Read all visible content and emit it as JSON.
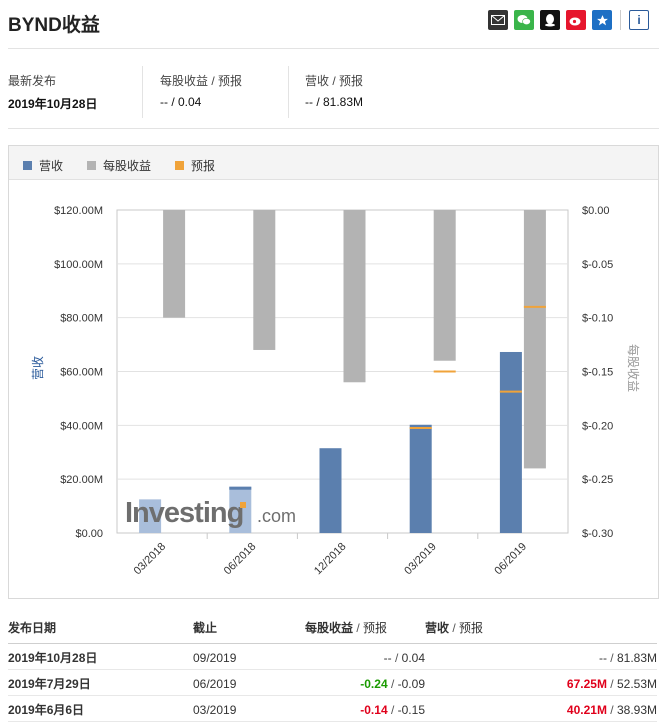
{
  "header": {
    "title": "BYND收益",
    "share_icons": [
      "mail-icon",
      "wechat-icon",
      "qq-icon",
      "weibo-icon",
      "star-icon",
      "info-icon"
    ]
  },
  "summary": {
    "latest_label": "最新发布",
    "latest_date": "2019年10月28日",
    "eps_label": "每股收益 / 预报",
    "eps_value": "-- / 0.04",
    "rev_label": "营收 / 预报",
    "rev_value": "-- / 81.83M"
  },
  "legend": {
    "revenue": "营收",
    "eps": "每股收益",
    "forecast": "预报"
  },
  "colors": {
    "revenue": "#5b7fae",
    "revenue_forecast_bar": "#a9bedb",
    "eps": "#b3b3b3",
    "forecast": "#f0a33a",
    "negative": "#e0001b",
    "positive": "#1a9b00"
  },
  "chart_data": {
    "type": "bar",
    "categories": [
      "03/2018",
      "06/2018",
      "12/2018",
      "03/2019",
      "06/2019"
    ],
    "y_left_label": "营收",
    "y_right_label": "每股收益",
    "y_left_ticks": [
      "$120.00M",
      "$100.00M",
      "$80.00M",
      "$60.00M",
      "$40.00M",
      "$20.00M",
      "$0.00"
    ],
    "y_right_ticks": [
      "$0.00",
      "$-0.05",
      "$-0.10",
      "$-0.15",
      "$-0.20",
      "$-0.25",
      "$-0.30"
    ],
    "y_left_range": [
      0,
      120
    ],
    "y_right_range": [
      -0.3,
      0
    ],
    "series": [
      {
        "name": "营收",
        "axis": "left",
        "values": [
          null,
          null,
          31.5,
          40.21,
          67.25
        ]
      },
      {
        "name": "营收 预报",
        "axis": "left",
        "values": [
          12.5,
          17.2,
          null,
          39.0,
          52.53
        ]
      },
      {
        "name": "每股收益",
        "axis": "right",
        "values": [
          -0.1,
          -0.13,
          -0.16,
          -0.14,
          -0.24
        ]
      },
      {
        "name": "预报",
        "axis": "right",
        "values": [
          null,
          null,
          null,
          -0.15,
          -0.09
        ]
      }
    ],
    "watermark": "Investing.com"
  },
  "table": {
    "headers": [
      "发布日期",
      "截止",
      "每股收益",
      "预报",
      "营收",
      "预报"
    ],
    "rows": [
      {
        "date": "2019年10月28日",
        "period": "09/2019",
        "eps": "--",
        "eps_fc": "0.04",
        "rev": "--",
        "rev_fc": "81.83M",
        "eps_class": "",
        "rev_class": ""
      },
      {
        "date": "2019年7月29日",
        "period": "06/2019",
        "eps": "-0.24",
        "eps_fc": "-0.09",
        "rev": "67.25M",
        "rev_fc": "52.53M",
        "eps_class": "pos",
        "rev_class": "neg"
      },
      {
        "date": "2019年6月6日",
        "period": "03/2019",
        "eps": "-0.14",
        "eps_fc": "-0.15",
        "rev": "40.21M",
        "rev_fc": "38.93M",
        "eps_class": "neg",
        "rev_class": "neg"
      }
    ]
  }
}
